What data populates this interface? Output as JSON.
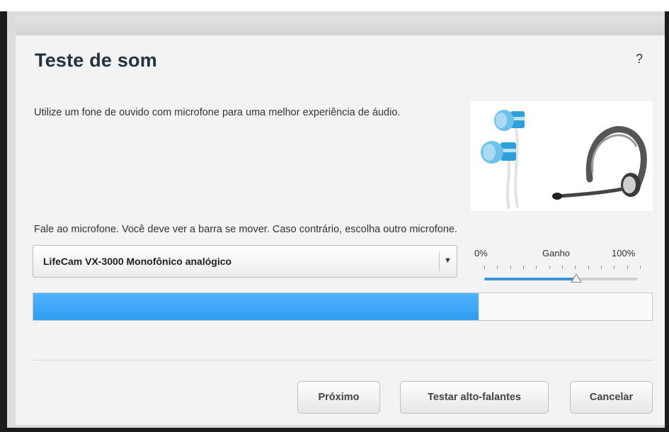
{
  "dialog": {
    "title": "Teste de som",
    "help_label": "?",
    "intro_text": "Utilize um fone de ouvido com microfone para uma melhor experiência de áudio.",
    "instruction_text": "Fale ao microfone. Você deve ver a barra se mover. Caso contrário, escolha outro microfone."
  },
  "microphone_select": {
    "selected": "LifeCam VX-3000 Monofônico analógico",
    "arrow_icon": "triangle-down-icon"
  },
  "gain": {
    "min_label": "0%",
    "label": "Ganho",
    "max_label": "100%",
    "value_fraction": 0.6
  },
  "level_meter": {
    "fill_fraction": 0.72,
    "color": "#3aa6f8"
  },
  "buttons": {
    "next": "Próximo",
    "test_speakers": "Testar alto-falantes",
    "cancel": "Cancelar"
  }
}
